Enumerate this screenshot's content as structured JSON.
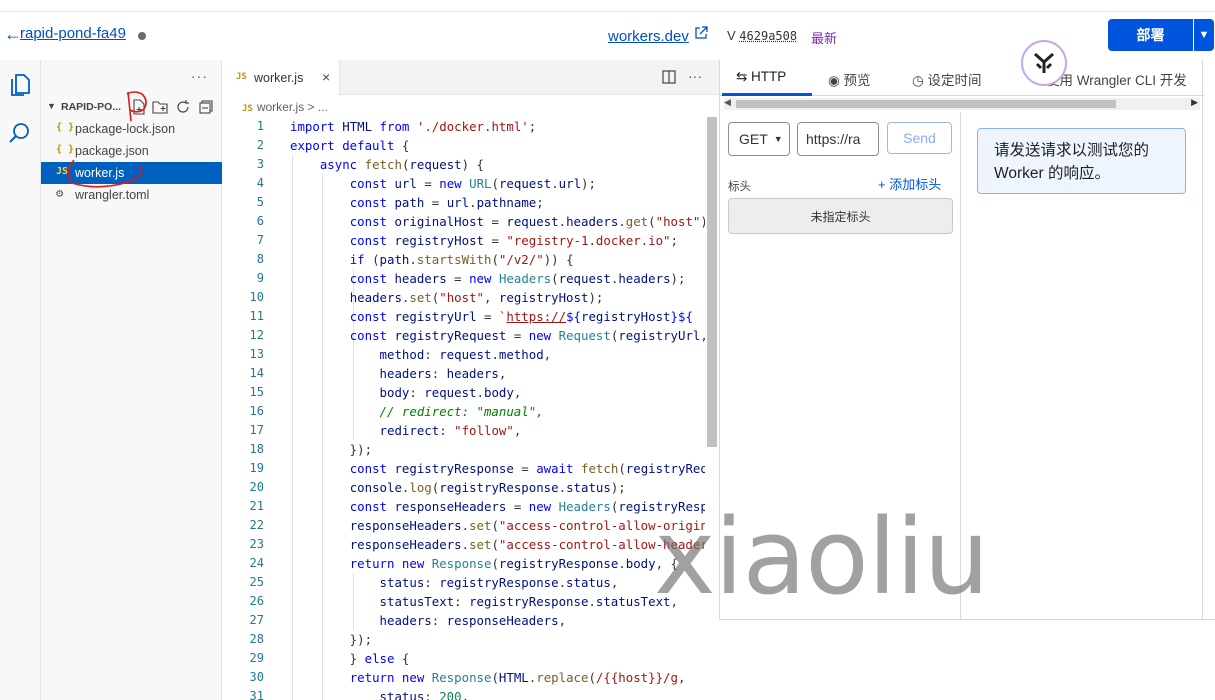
{
  "header": {
    "back_arrow": "←",
    "project_name": "rapid-pond-fa49",
    "workers_link": "workers.dev",
    "version_prefix": "V",
    "version_hash": "4629a508",
    "version_status": "最新",
    "deploy_label": "部署",
    "accent_color": "#0055dc"
  },
  "activity_bar": {
    "icons": [
      "files-icon",
      "search-icon"
    ]
  },
  "explorer": {
    "more_label": "···",
    "root_label": "RAPID-PO...",
    "files": [
      {
        "icon": "{ }",
        "name": "package-lock.json"
      },
      {
        "icon": "{ }",
        "name": "package.json"
      },
      {
        "icon": "JS",
        "name": "worker.js"
      },
      {
        "icon": "⚙",
        "name": "wrangler.toml"
      }
    ]
  },
  "editor": {
    "tab_icon": "JS",
    "tab_name": "worker.js",
    "tab_close": "×",
    "tab_more": "···",
    "breadcrumb_icon": "JS",
    "breadcrumb_text": "worker.js > ...",
    "line_numbers": [
      "1",
      "2",
      "3",
      "4",
      "5",
      "6",
      "7",
      "8",
      "9",
      "10",
      "11",
      "12",
      "13",
      "14",
      "15",
      "16",
      "17",
      "18",
      "19",
      "20",
      "21",
      "22",
      "23",
      "24",
      "25",
      "26",
      "27",
      "28",
      "29",
      "30",
      "31"
    ]
  },
  "right_panel": {
    "tabs": [
      "⇆ HTTP",
      "◉ 预览",
      "◷ 设定时间",
      "使用 Wrangler CLI 开发"
    ],
    "method": "GET",
    "url_value": "https://ra",
    "send_label": "Send",
    "headers_label": "标头",
    "add_header_label": "+ 添加标头",
    "no_header_label": "未指定标头",
    "response_message": "请发送请求以测试您的 Worker 的响应。"
  },
  "watermark": "xiaoliu"
}
